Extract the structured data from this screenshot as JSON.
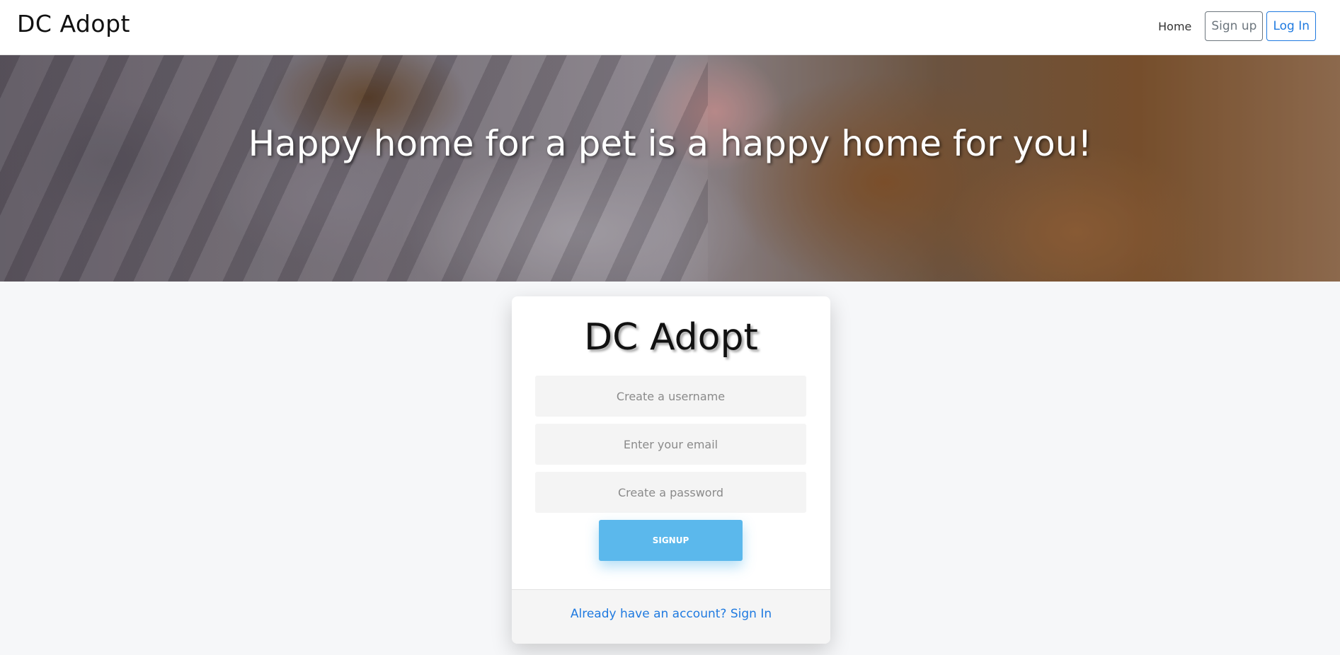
{
  "navbar": {
    "brand": "DC Adopt",
    "home_label": "Home",
    "signup_label": "Sign up",
    "login_label": "Log In"
  },
  "hero": {
    "title": "Happy home for a pet is a happy home for you!"
  },
  "signup_card": {
    "logo": "DC Adopt",
    "username_placeholder": "Create a username",
    "email_placeholder": "Enter your email",
    "password_placeholder": "Create a password",
    "submit_label": "SIGNUP",
    "signin_link": "Already have an account? Sign In"
  },
  "colors": {
    "primary_link": "#1f7ae0",
    "signup_button": "#5bb8ec",
    "page_background": "#f6f7f9"
  }
}
